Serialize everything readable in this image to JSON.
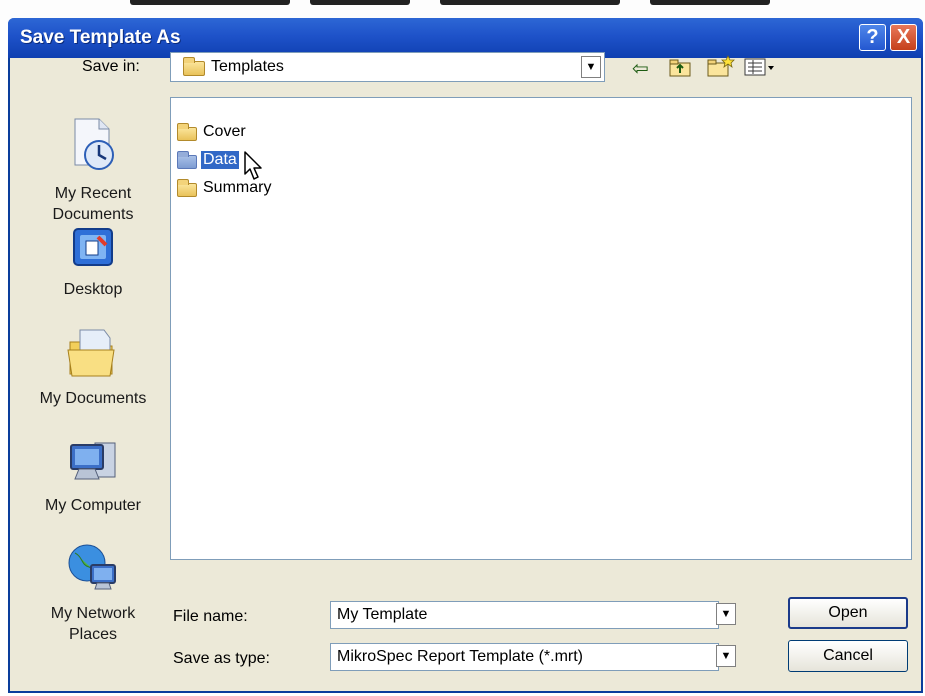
{
  "window": {
    "title": "Save Template As"
  },
  "titlebar_buttons": {
    "help": "?",
    "close": "X"
  },
  "save_in": {
    "label": "Save in:",
    "value": "Templates"
  },
  "toolbar": {
    "back_icon": "back-arrow-icon",
    "up_icon": "up-folder-icon",
    "new_folder_icon": "new-folder-icon",
    "views_icon": "views-menu-icon"
  },
  "places": [
    {
      "label": "My Recent\nDocuments",
      "icon": "recent-documents-icon"
    },
    {
      "label": "Desktop",
      "icon": "desktop-icon"
    },
    {
      "label": "My Documents",
      "icon": "my-documents-icon"
    },
    {
      "label": "My Computer",
      "icon": "my-computer-icon"
    },
    {
      "label": "My Network\nPlaces",
      "icon": "network-places-icon"
    }
  ],
  "files": [
    {
      "name": "Cover",
      "selected": false
    },
    {
      "name": "Data",
      "selected": true
    },
    {
      "name": "Summary",
      "selected": false
    }
  ],
  "file_name": {
    "label": "File name:",
    "value": "My Template"
  },
  "save_as_type": {
    "label": "Save as type:",
    "value": "MikroSpec Report Template (*.mrt)"
  },
  "buttons": {
    "open": "Open",
    "cancel": "Cancel"
  },
  "colors": {
    "titlebar": "#1e52c9",
    "selection": "#3168c6",
    "dialog_bg": "#ece9d8"
  }
}
